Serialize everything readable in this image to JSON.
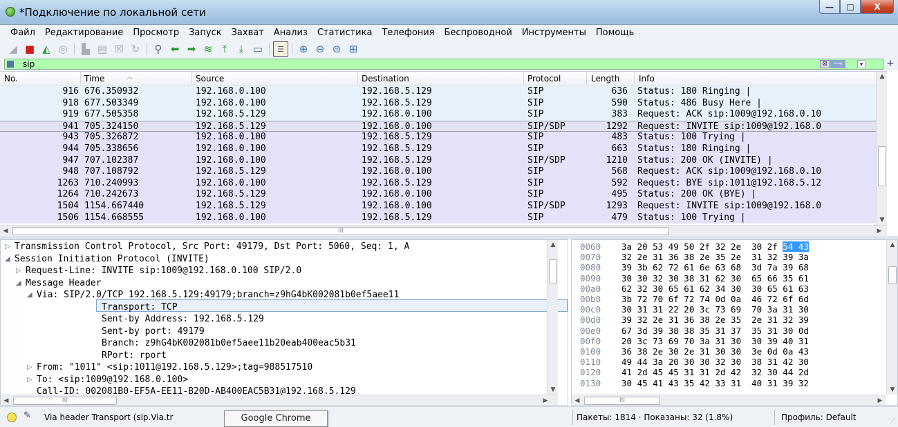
{
  "window": {
    "title": "*Подключение по локальной сети",
    "min_label": "—",
    "max_label": "□",
    "close_label": "X"
  },
  "menu": [
    "Файл",
    "Редактирование",
    "Просмотр",
    "Запуск",
    "Захват",
    "Анализ",
    "Статистика",
    "Телефония",
    "Беспроводной",
    "Инструменты",
    "Помощь"
  ],
  "toolbar_icons": [
    "shark-fin-start-icon",
    "stop-capture-icon",
    "restart-capture-icon",
    "capture-options-icon",
    "open-file-icon",
    "save-file-icon",
    "close-file-icon",
    "reload-file-icon",
    "find-packet-icon",
    "go-back-icon",
    "go-forward-icon",
    "go-to-packet-icon",
    "go-first-icon",
    "go-last-icon",
    "auto-scroll-icon",
    "colorize-icon",
    "zoom-in-icon",
    "zoom-out-icon",
    "normal-size-icon",
    "resize-columns-icon"
  ],
  "filter": {
    "value": "sip"
  },
  "packet_list": {
    "columns": [
      "No.",
      "Time",
      "Source",
      "Destination",
      "Protocol",
      "Length",
      "Info"
    ],
    "rows": [
      {
        "no": "916",
        "time": "676.350932",
        "src": "192.168.0.100",
        "dst": "192.168.5.129",
        "proto": "SIP",
        "len": "636",
        "info": "Status: 180 Ringing |",
        "bg": "#e7f1fb"
      },
      {
        "no": "918",
        "time": "677.503349",
        "src": "192.168.0.100",
        "dst": "192.168.5.129",
        "proto": "SIP",
        "len": "590",
        "info": "Status: 486 Busy Here |",
        "bg": "#e7f1fb"
      },
      {
        "no": "919",
        "time": "677.505358",
        "src": "192.168.5.129",
        "dst": "192.168.0.100",
        "proto": "SIP",
        "len": "383",
        "info": "Request: ACK sip:1009@192.168.0.10",
        "bg": "#e7f1fb"
      },
      {
        "no": "941",
        "time": "705.324150",
        "src": "192.168.5.129",
        "dst": "192.168.0.100",
        "proto": "SIP/SDP",
        "len": "1292",
        "info": "Request: INVITE sip:1009@192.168.0",
        "bg": "#e4e2f2"
      },
      {
        "no": "943",
        "time": "705.326872",
        "src": "192.168.0.100",
        "dst": "192.168.5.129",
        "proto": "SIP",
        "len": "483",
        "info": "Status: 100 Trying |",
        "bg": "#e4e2f8"
      },
      {
        "no": "944",
        "time": "705.338656",
        "src": "192.168.0.100",
        "dst": "192.168.5.129",
        "proto": "SIP",
        "len": "663",
        "info": "Status: 180 Ringing |",
        "bg": "#e4e2f8"
      },
      {
        "no": "947",
        "time": "707.102387",
        "src": "192.168.0.100",
        "dst": "192.168.5.129",
        "proto": "SIP/SDP",
        "len": "1210",
        "info": "Status: 200 OK (INVITE) |",
        "bg": "#e4e2f8"
      },
      {
        "no": "948",
        "time": "707.108792",
        "src": "192.168.5.129",
        "dst": "192.168.0.100",
        "proto": "SIP",
        "len": "568",
        "info": "Request: ACK sip:1009@192.168.0.10",
        "bg": "#e4e2f8"
      },
      {
        "no": "1263",
        "time": "710.240993",
        "src": "192.168.0.100",
        "dst": "192.168.5.129",
        "proto": "SIP",
        "len": "592",
        "info": "Request: BYE sip:1011@192.168.5.12",
        "bg": "#e4e2f8"
      },
      {
        "no": "1264",
        "time": "710.242673",
        "src": "192.168.5.129",
        "dst": "192.168.0.100",
        "proto": "SIP",
        "len": "495",
        "info": "Status: 200 OK (BYE) |",
        "bg": "#e4e2f8"
      },
      {
        "no": "1504",
        "time": "1154.667440",
        "src": "192.168.5.129",
        "dst": "192.168.0.100",
        "proto": "SIP/SDP",
        "len": "1293",
        "info": "Request: INVITE sip:1009@192.168.0",
        "bg": "#e4e2f8"
      },
      {
        "no": "1506",
        "time": "1154.668555",
        "src": "192.168.0.100",
        "dst": "192.168.5.129",
        "proto": "SIP",
        "len": "479",
        "info": "Status: 100 Trying |",
        "bg": "#e4e2f8"
      }
    ],
    "hscroll_mark": "III"
  },
  "details": {
    "rows": [
      {
        "twisty": "▷",
        "text": "Transmission Control Protocol, Src Port: 49179, Dst Port: 5060, Seq: 1, A"
      },
      {
        "twisty": "◢",
        "text": "Session Initiation Protocol (INVITE)"
      },
      {
        "twisty": "▷",
        "text": "Request-Line: INVITE sip:1009@192.168.0.100 SIP/2.0"
      },
      {
        "twisty": "◢",
        "text": "Message Header"
      },
      {
        "twisty": "◢",
        "text": "Via: SIP/2.0/TCP 192.168.5.129:49179;branch=z9hG4bK002081b0ef5aee11"
      },
      {
        "twisty": "",
        "text": "Transport: TCP"
      },
      {
        "twisty": "",
        "text": "Sent-by Address: 192.168.5.129"
      },
      {
        "twisty": "",
        "text": "Sent-by port: 49179"
      },
      {
        "twisty": "",
        "text": "Branch: z9hG4bK002081b0ef5aee11b20eab400eac5b31"
      },
      {
        "twisty": "",
        "text": "RPort: rport"
      },
      {
        "twisty": "▷",
        "text": "From: \"1011\" <sip:1011@192.168.5.129>;tag=988517510"
      },
      {
        "twisty": "▷",
        "text": "To: <sip:1009@192.168.0.100>"
      },
      {
        "twisty": "",
        "text": "Call-ID: 002081B0-EF5A-EE11-B20D-AB400EAC5B31@192.168.5.129"
      }
    ],
    "hscroll_mark": "III"
  },
  "bytes": {
    "rows": [
      {
        "off": "0060",
        "hex": "3a 20 53 49 50 2f 32 2e  30 2f ",
        "hl": "54 43"
      },
      {
        "off": "0070",
        "hex": "32 2e 31 36 38 2e 35 2e  31 32 39 3a",
        "hl": ""
      },
      {
        "off": "0080",
        "hex": "39 3b 62 72 61 6e 63 68  3d 7a 39 68",
        "hl": ""
      },
      {
        "off": "0090",
        "hex": "30 30 32 30 38 31 62 30  65 66 35 61",
        "hl": ""
      },
      {
        "off": "00a0",
        "hex": "62 32 30 65 61 62 34 30  30 65 61 63",
        "hl": ""
      },
      {
        "off": "00b0",
        "hex": "3b 72 70 6f 72 74 0d 0a  46 72 6f 6d",
        "hl": ""
      },
      {
        "off": "00c0",
        "hex": "30 31 31 22 20 3c 73 69  70 3a 31 30",
        "hl": ""
      },
      {
        "off": "00d0",
        "hex": "39 32 2e 31 36 38 2e 35  2e 31 32 39",
        "hl": ""
      },
      {
        "off": "00e0",
        "hex": "67 3d 39 38 38 35 31 37  35 31 30 0d",
        "hl": ""
      },
      {
        "off": "00f0",
        "hex": "20 3c 73 69 70 3a 31 30  30 39 40 31",
        "hl": ""
      },
      {
        "off": "0100",
        "hex": "36 38 2e 30 2e 31 30 30  3e 0d 0a 43",
        "hl": ""
      },
      {
        "off": "0110",
        "hex": "49 44 3a 20 30 30 32 30  38 31 42 30",
        "hl": ""
      },
      {
        "off": "0120",
        "hex": "41 2d 45 45 31 31 2d 42  32 30 44 2d",
        "hl": ""
      },
      {
        "off": "0130",
        "hex": "30 45 41 43 35 42 33 31  40 31 39 32",
        "hl": ""
      }
    ],
    "hscroll_mark": "III"
  },
  "status": {
    "field_text": "Via header Transport (sip.Via.tr",
    "tooltip": "Google Chrome",
    "packets": "Пакеты: 1814 · Показаны: 32 (1.8%)",
    "profile": "Профиль: Default"
  }
}
